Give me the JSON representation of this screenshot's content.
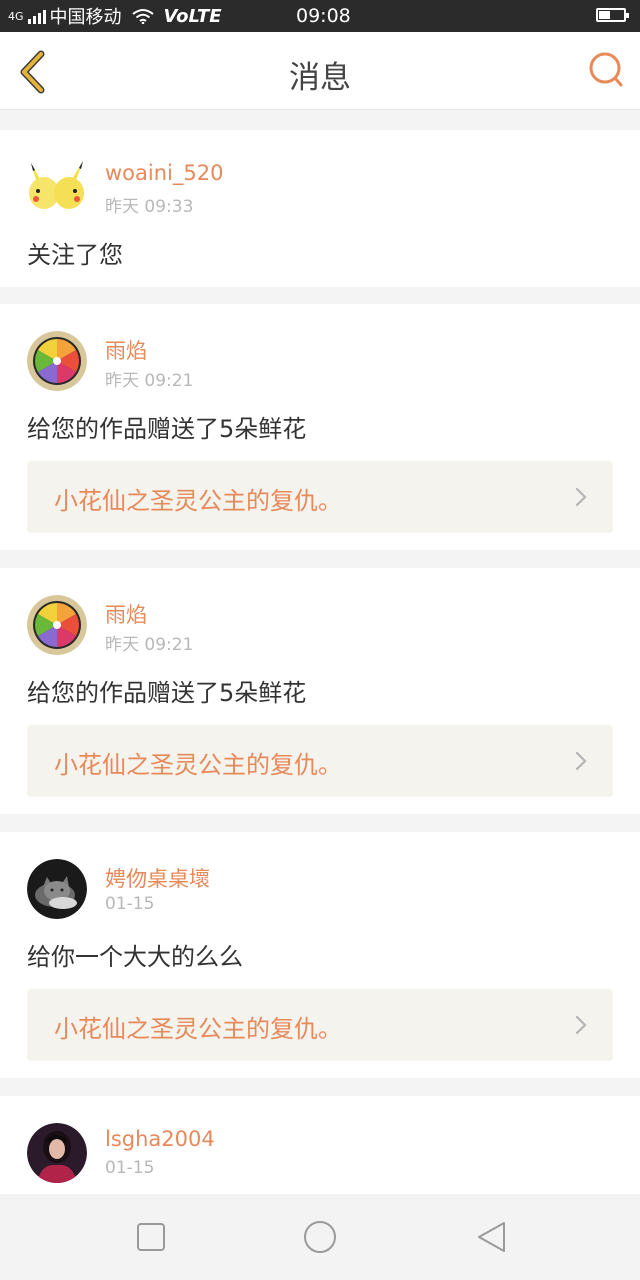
{
  "status_bar": {
    "network_type": "4G",
    "carrier": "中国移动",
    "volte": "VoLTE",
    "time": "09:08"
  },
  "header": {
    "title": "消息",
    "back_icon": "chevron-left-icon",
    "search_icon": "search-icon"
  },
  "colors": {
    "accent": "#e8895a",
    "back_arrow": "#e6b33a"
  },
  "notifications": [
    {
      "username": "woaini_520",
      "time": "昨天 09:33",
      "message": "关注了您",
      "avatar": "pikachu-avatar"
    },
    {
      "username": "雨焰",
      "time": "昨天 09:21",
      "message": "给您的作品赠送了5朵鲜花",
      "work_title": "小花仙之圣灵公主的复仇。",
      "avatar": "color-wheel-avatar"
    },
    {
      "username": "雨焰",
      "time": "昨天 09:21",
      "message": "给您的作品赠送了5朵鲜花",
      "work_title": "小花仙之圣灵公主的复仇。",
      "avatar": "color-wheel-avatar"
    },
    {
      "username": "娉伆桌桌壞",
      "time": "01-15",
      "message": "给你一个大大的么么",
      "work_title": "小花仙之圣灵公主的复仇。",
      "avatar": "cat-avatar"
    },
    {
      "username": "lsgha2004",
      "time": "01-15",
      "avatar": "girl-avatar"
    }
  ],
  "nav_bar": {
    "buttons": [
      "recent-apps-icon",
      "home-icon",
      "back-triangle-icon"
    ]
  }
}
